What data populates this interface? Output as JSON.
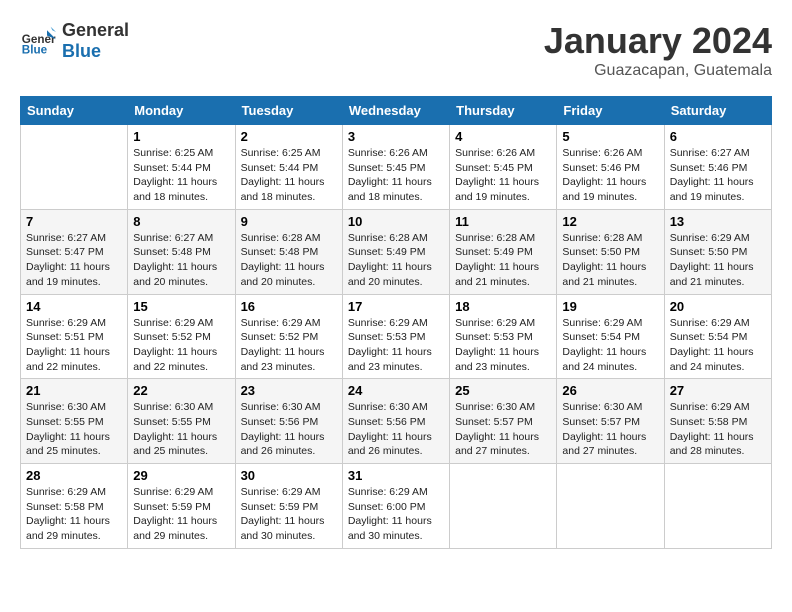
{
  "logo": {
    "line1": "General",
    "line2": "Blue"
  },
  "title": "January 2024",
  "location": "Guazacapan, Guatemala",
  "days_header": [
    "Sunday",
    "Monday",
    "Tuesday",
    "Wednesday",
    "Thursday",
    "Friday",
    "Saturday"
  ],
  "weeks": [
    [
      {
        "num": "",
        "text": ""
      },
      {
        "num": "1",
        "text": "Sunrise: 6:25 AM\nSunset: 5:44 PM\nDaylight: 11 hours\nand 18 minutes."
      },
      {
        "num": "2",
        "text": "Sunrise: 6:25 AM\nSunset: 5:44 PM\nDaylight: 11 hours\nand 18 minutes."
      },
      {
        "num": "3",
        "text": "Sunrise: 6:26 AM\nSunset: 5:45 PM\nDaylight: 11 hours\nand 18 minutes."
      },
      {
        "num": "4",
        "text": "Sunrise: 6:26 AM\nSunset: 5:45 PM\nDaylight: 11 hours\nand 19 minutes."
      },
      {
        "num": "5",
        "text": "Sunrise: 6:26 AM\nSunset: 5:46 PM\nDaylight: 11 hours\nand 19 minutes."
      },
      {
        "num": "6",
        "text": "Sunrise: 6:27 AM\nSunset: 5:46 PM\nDaylight: 11 hours\nand 19 minutes."
      }
    ],
    [
      {
        "num": "7",
        "text": "Sunrise: 6:27 AM\nSunset: 5:47 PM\nDaylight: 11 hours\nand 19 minutes."
      },
      {
        "num": "8",
        "text": "Sunrise: 6:27 AM\nSunset: 5:48 PM\nDaylight: 11 hours\nand 20 minutes."
      },
      {
        "num": "9",
        "text": "Sunrise: 6:28 AM\nSunset: 5:48 PM\nDaylight: 11 hours\nand 20 minutes."
      },
      {
        "num": "10",
        "text": "Sunrise: 6:28 AM\nSunset: 5:49 PM\nDaylight: 11 hours\nand 20 minutes."
      },
      {
        "num": "11",
        "text": "Sunrise: 6:28 AM\nSunset: 5:49 PM\nDaylight: 11 hours\nand 21 minutes."
      },
      {
        "num": "12",
        "text": "Sunrise: 6:28 AM\nSunset: 5:50 PM\nDaylight: 11 hours\nand 21 minutes."
      },
      {
        "num": "13",
        "text": "Sunrise: 6:29 AM\nSunset: 5:50 PM\nDaylight: 11 hours\nand 21 minutes."
      }
    ],
    [
      {
        "num": "14",
        "text": "Sunrise: 6:29 AM\nSunset: 5:51 PM\nDaylight: 11 hours\nand 22 minutes."
      },
      {
        "num": "15",
        "text": "Sunrise: 6:29 AM\nSunset: 5:52 PM\nDaylight: 11 hours\nand 22 minutes."
      },
      {
        "num": "16",
        "text": "Sunrise: 6:29 AM\nSunset: 5:52 PM\nDaylight: 11 hours\nand 23 minutes."
      },
      {
        "num": "17",
        "text": "Sunrise: 6:29 AM\nSunset: 5:53 PM\nDaylight: 11 hours\nand 23 minutes."
      },
      {
        "num": "18",
        "text": "Sunrise: 6:29 AM\nSunset: 5:53 PM\nDaylight: 11 hours\nand 23 minutes."
      },
      {
        "num": "19",
        "text": "Sunrise: 6:29 AM\nSunset: 5:54 PM\nDaylight: 11 hours\nand 24 minutes."
      },
      {
        "num": "20",
        "text": "Sunrise: 6:29 AM\nSunset: 5:54 PM\nDaylight: 11 hours\nand 24 minutes."
      }
    ],
    [
      {
        "num": "21",
        "text": "Sunrise: 6:30 AM\nSunset: 5:55 PM\nDaylight: 11 hours\nand 25 minutes."
      },
      {
        "num": "22",
        "text": "Sunrise: 6:30 AM\nSunset: 5:55 PM\nDaylight: 11 hours\nand 25 minutes."
      },
      {
        "num": "23",
        "text": "Sunrise: 6:30 AM\nSunset: 5:56 PM\nDaylight: 11 hours\nand 26 minutes."
      },
      {
        "num": "24",
        "text": "Sunrise: 6:30 AM\nSunset: 5:56 PM\nDaylight: 11 hours\nand 26 minutes."
      },
      {
        "num": "25",
        "text": "Sunrise: 6:30 AM\nSunset: 5:57 PM\nDaylight: 11 hours\nand 27 minutes."
      },
      {
        "num": "26",
        "text": "Sunrise: 6:30 AM\nSunset: 5:57 PM\nDaylight: 11 hours\nand 27 minutes."
      },
      {
        "num": "27",
        "text": "Sunrise: 6:29 AM\nSunset: 5:58 PM\nDaylight: 11 hours\nand 28 minutes."
      }
    ],
    [
      {
        "num": "28",
        "text": "Sunrise: 6:29 AM\nSunset: 5:58 PM\nDaylight: 11 hours\nand 29 minutes."
      },
      {
        "num": "29",
        "text": "Sunrise: 6:29 AM\nSunset: 5:59 PM\nDaylight: 11 hours\nand 29 minutes."
      },
      {
        "num": "30",
        "text": "Sunrise: 6:29 AM\nSunset: 5:59 PM\nDaylight: 11 hours\nand 30 minutes."
      },
      {
        "num": "31",
        "text": "Sunrise: 6:29 AM\nSunset: 6:00 PM\nDaylight: 11 hours\nand 30 minutes."
      },
      {
        "num": "",
        "text": ""
      },
      {
        "num": "",
        "text": ""
      },
      {
        "num": "",
        "text": ""
      }
    ]
  ]
}
